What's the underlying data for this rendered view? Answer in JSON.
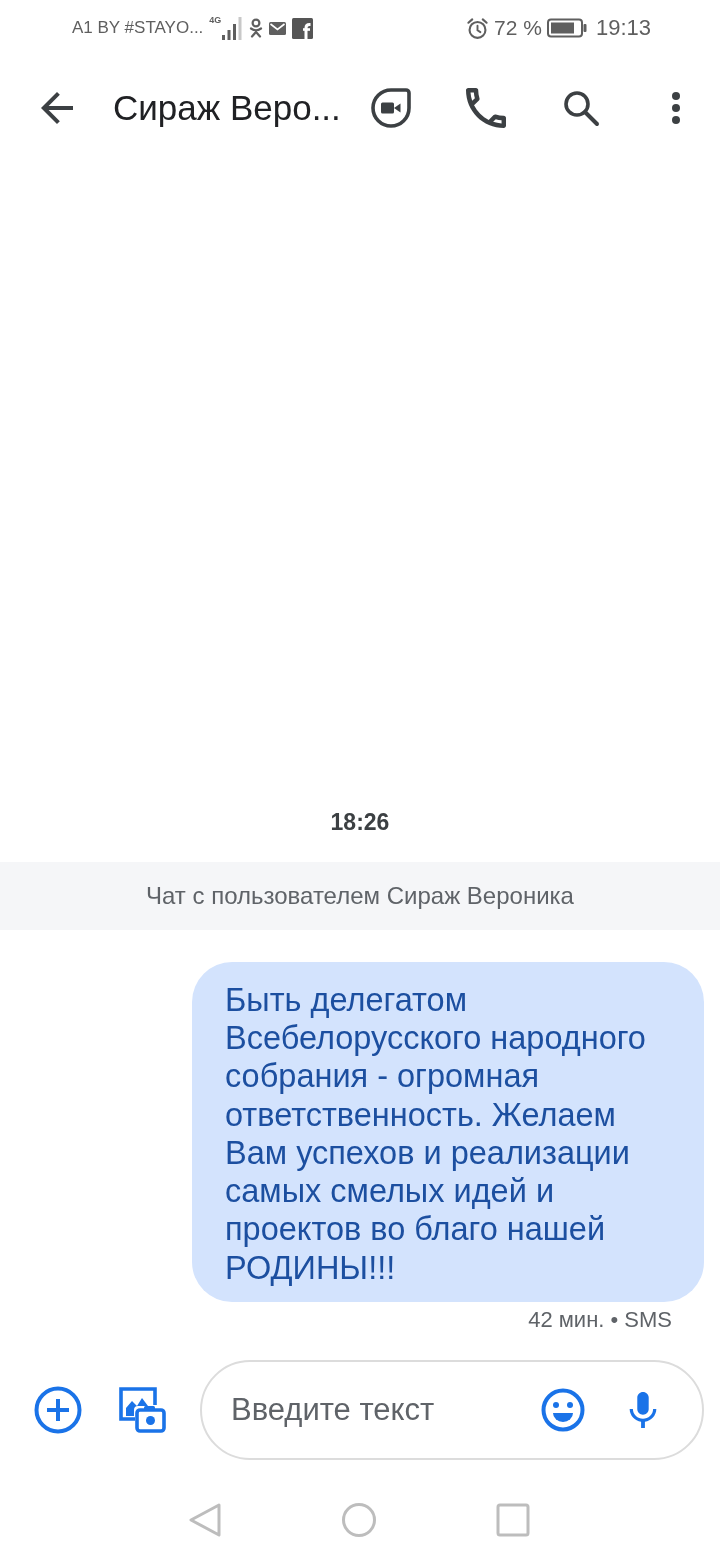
{
  "status_bar": {
    "carrier": "A1 BY #STAYO...",
    "network_type": "4G",
    "battery_percent": "72 %",
    "time": "19:13"
  },
  "app_bar": {
    "title": "Сираж Веро..."
  },
  "conversation": {
    "timestamp": "18:26",
    "banner": "Чат с пользователем Сираж Вероника",
    "messages": [
      {
        "outgoing": true,
        "text": "Быть делегатом Всебелорусского народного собрания - огромная ответственность. Желаем Вам успехов и реализации самых смелых идей и проектов во благо нашей РОДИНЫ!!!",
        "meta": "42 мин. • SMS"
      }
    ]
  },
  "compose": {
    "placeholder": "Введите текст"
  }
}
